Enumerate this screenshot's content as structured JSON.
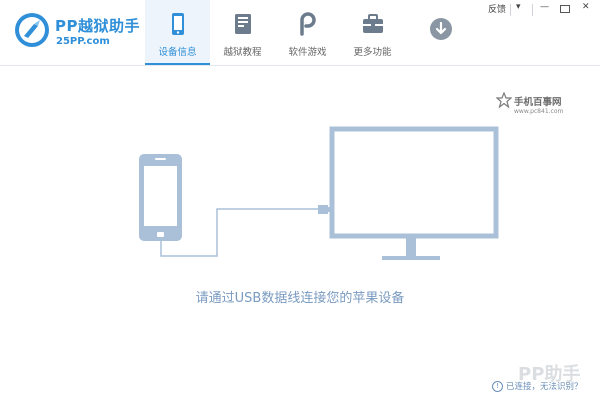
{
  "app": {
    "title": "PP越狱助手",
    "domain": "25PP.com",
    "brand_color": "#2f8fd8"
  },
  "tabs": [
    {
      "label": "设备信息",
      "icon": "phone-icon",
      "active": true
    },
    {
      "label": "越狱教程",
      "icon": "book-icon",
      "active": false
    },
    {
      "label": "软件游戏",
      "icon": "pp-store-icon",
      "active": false
    },
    {
      "label": "更多功能",
      "icon": "toolbox-icon",
      "active": false
    }
  ],
  "window": {
    "feedback": "反馈",
    "menu": "▾",
    "minimize": "—",
    "close": "✕"
  },
  "main": {
    "prompt": "请通过USB数据线连接您的苹果设备"
  },
  "watermark": {
    "brand": "手机百事网",
    "url": "www.pc841.com",
    "pp_mark": "PP助手"
  },
  "status": {
    "text": "已连接，无法识别？"
  },
  "colors": {
    "illustration": "#a9c0d8",
    "prompt": "#7a9bc1"
  }
}
